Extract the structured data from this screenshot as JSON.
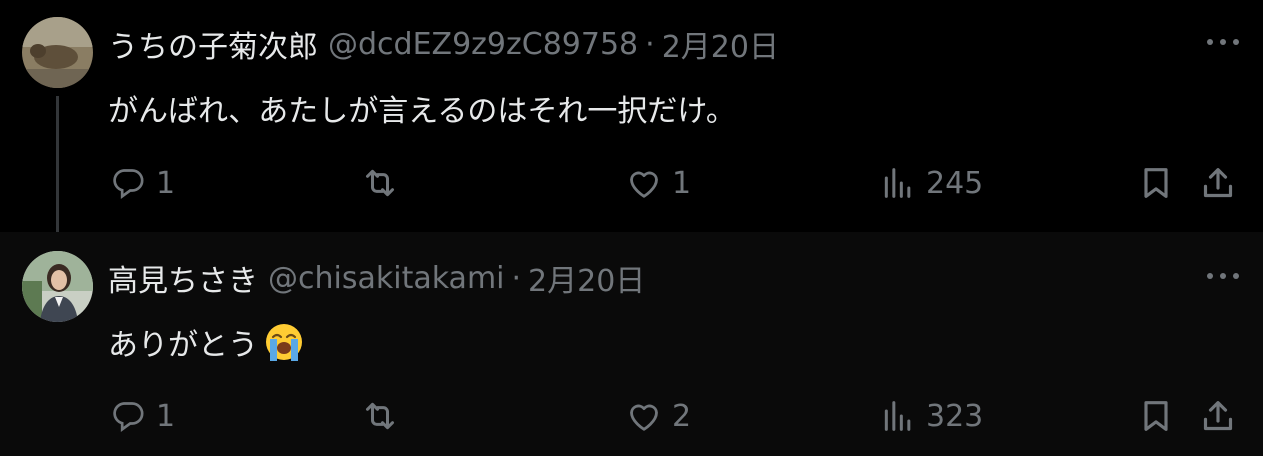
{
  "tweets": [
    {
      "name": "うちの子菊次郎",
      "handle": "@dcdEZ9z9zC89758",
      "separator": "·",
      "date": "2月20日",
      "text": "がんばれ、あたしが言えるのはそれ一択だけ。",
      "emoji": "",
      "replies": "1",
      "retweets": "",
      "likes": "1",
      "views": "245"
    },
    {
      "name": "高見ちさき",
      "handle": "@chisakitakami",
      "separator": "·",
      "date": "2月20日",
      "text": "ありがとう",
      "emoji": "loudly-crying-face",
      "replies": "1",
      "retweets": "",
      "likes": "2",
      "views": "323"
    }
  ],
  "colors": {
    "background": "#000000",
    "reply_background": "#0a0a0a",
    "text_primary": "#e7e9ea",
    "text_secondary": "#71767b",
    "thread_line": "#333639"
  },
  "icons": [
    "reply-icon",
    "retweet-icon",
    "like-icon",
    "views-icon",
    "bookmark-icon",
    "share-icon",
    "more-icon"
  ]
}
